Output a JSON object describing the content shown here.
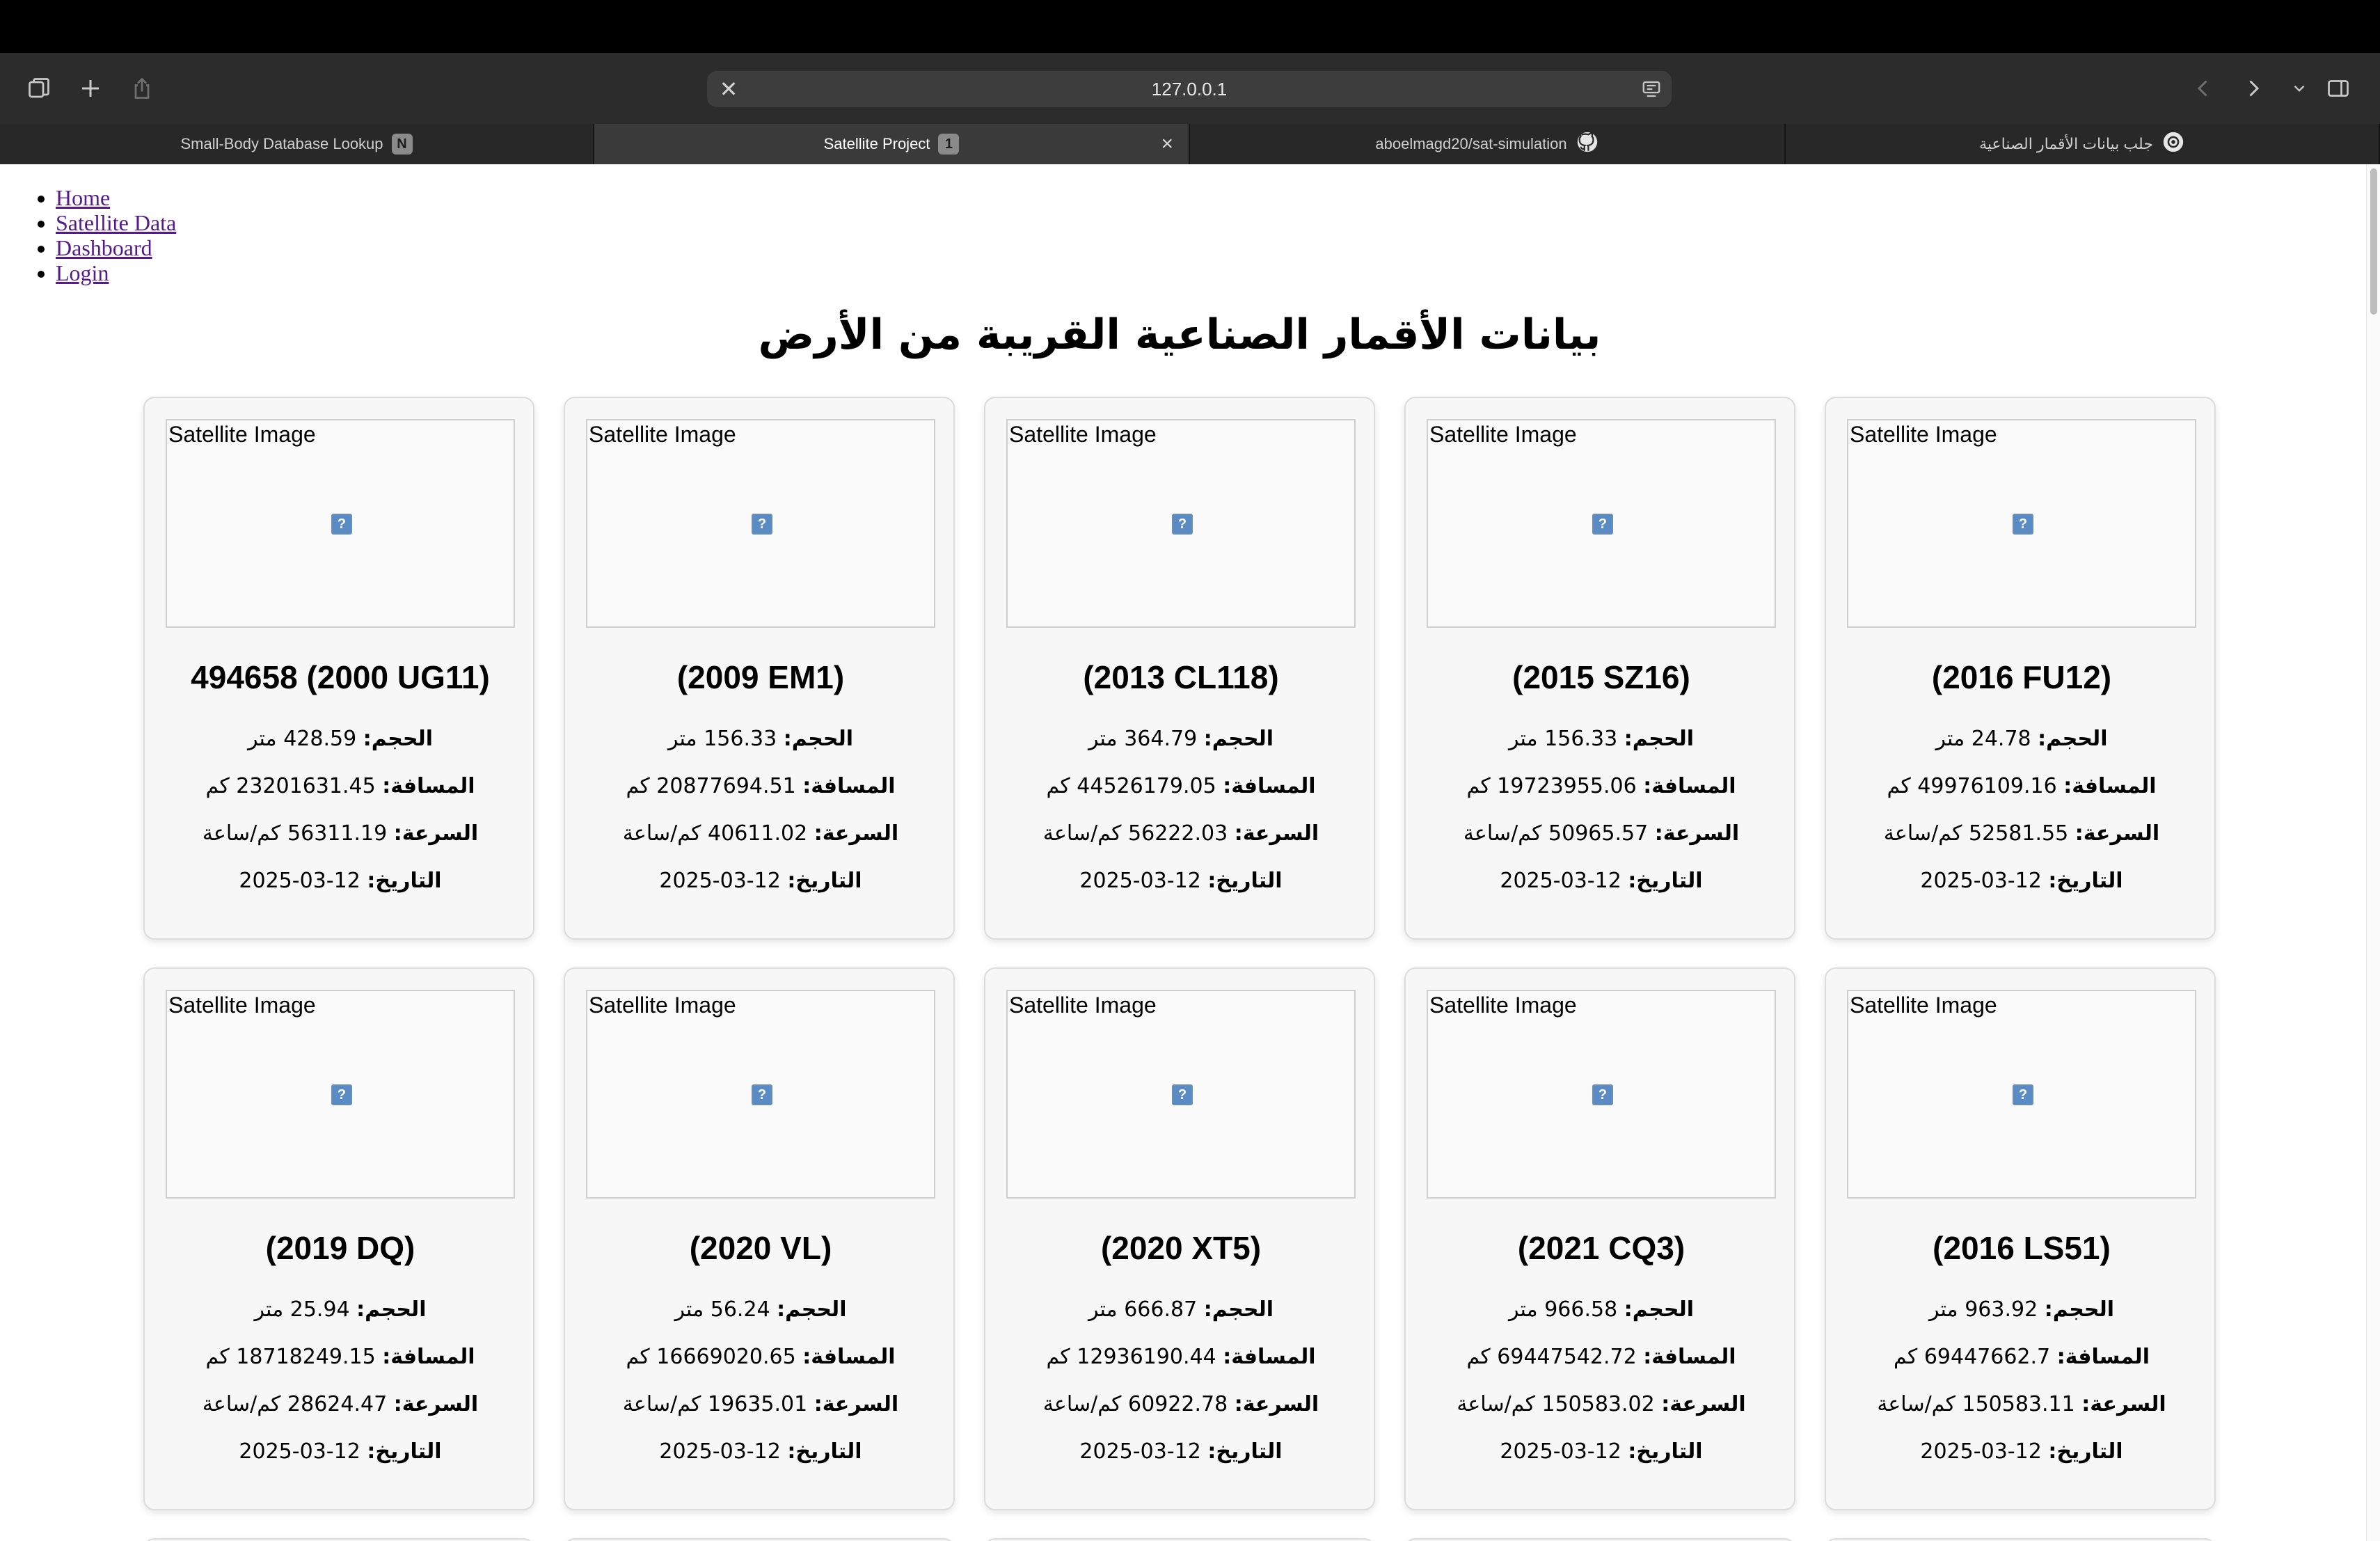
{
  "browser": {
    "url": "127.0.0.1",
    "tabs": [
      {
        "label": "Small-Body Database Lookup",
        "badge": "N"
      },
      {
        "label": "Satellite Project",
        "badge": "1"
      },
      {
        "label": "aboelmagd20/sat-simulation",
        "badge": ""
      },
      {
        "label": "جلب بيانات الأقمار الصناعية",
        "badge": ""
      }
    ]
  },
  "nav": {
    "items": [
      "Home",
      "Satellite Data",
      "Dashboard",
      "Login"
    ]
  },
  "page": {
    "title": "بيانات الأقمار الصناعية القريبة من الأرض",
    "image_alt": "Satellite Image",
    "labels": {
      "size": "الحجم:",
      "distance": "المسافة:",
      "speed": "السرعة:",
      "date": "التاريخ:",
      "meter": "متر",
      "km": "كم",
      "kmh": "كم/ساعة"
    }
  },
  "satellites": [
    {
      "name": "494658 (2000 UG11)",
      "size": "428.59",
      "distance": "23201631.45",
      "speed": "56311.19",
      "date": "12-03-2025"
    },
    {
      "name": "(2009 EM1)",
      "size": "156.33",
      "distance": "20877694.51",
      "speed": "40611.02",
      "date": "12-03-2025"
    },
    {
      "name": "(2013 CL118)",
      "size": "364.79",
      "distance": "44526179.05",
      "speed": "56222.03",
      "date": "12-03-2025"
    },
    {
      "name": "(2015 SZ16)",
      "size": "156.33",
      "distance": "19723955.06",
      "speed": "50965.57",
      "date": "12-03-2025"
    },
    {
      "name": "(2016 FU12)",
      "size": "24.78",
      "distance": "49976109.16",
      "speed": "52581.55",
      "date": "12-03-2025"
    },
    {
      "name": "(2019 DQ)",
      "size": "25.94",
      "distance": "18718249.15",
      "speed": "28624.47",
      "date": "12-03-2025"
    },
    {
      "name": "(2020 VL)",
      "size": "56.24",
      "distance": "16669020.65",
      "speed": "19635.01",
      "date": "12-03-2025"
    },
    {
      "name": "(2020 XT5)",
      "size": "666.87",
      "distance": "12936190.44",
      "speed": "60922.78",
      "date": "12-03-2025"
    },
    {
      "name": "(2021 CQ3)",
      "size": "966.58",
      "distance": "69447542.72",
      "speed": "150583.02",
      "date": "12-03-2025"
    },
    {
      "name": "(2016 LS51)",
      "size": "963.92",
      "distance": "69447662.7",
      "speed": "150583.11",
      "date": "12-03-2025"
    }
  ]
}
